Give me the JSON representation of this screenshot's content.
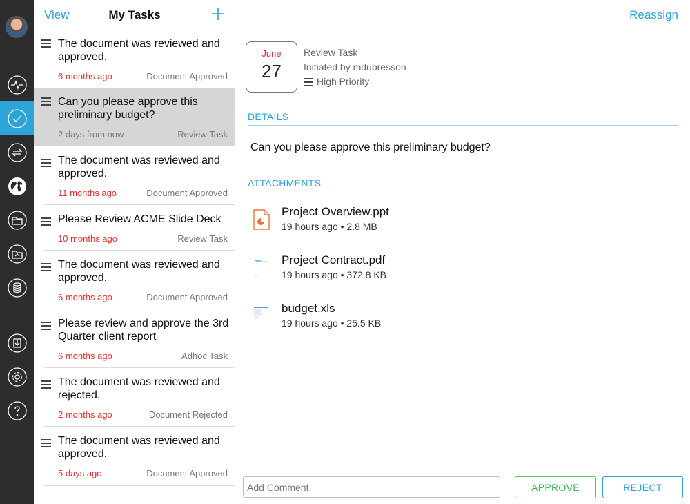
{
  "rail": {
    "icons": [
      "avatar",
      "activity-icon",
      "tasks-checkmark-icon",
      "sync-icon",
      "globe-icon",
      "folder-icon",
      "shared-folder-icon",
      "database-icon",
      "download-icon",
      "gear-icon",
      "help-icon"
    ],
    "active_icon": "tasks-checkmark-icon",
    "accent": "#2ea3d8",
    "background": "#2d2d2d"
  },
  "list": {
    "view_label": "View",
    "title": "My Tasks",
    "add_icon": "plus-icon",
    "tasks": [
      {
        "title": "The document was reviewed and approved.",
        "when": "6 months ago",
        "type": "Document Approved"
      },
      {
        "title": "Can you please approve this preliminary budget?",
        "when": "2 days from now",
        "type": "Review Task",
        "selected": true
      },
      {
        "title": "The document was reviewed and approved.",
        "when": "11 months ago",
        "type": "Document Approved"
      },
      {
        "title": "Please Review ACME Slide Deck",
        "when": "10 months ago",
        "type": "Review Task"
      },
      {
        "title": "The document was reviewed and approved.",
        "when": "6 months ago",
        "type": "Document Approved"
      },
      {
        "title": "Please review and approve the 3rd Quarter client report",
        "when": "6 months ago",
        "type": "Adhoc Task"
      },
      {
        "title": "The document was reviewed and rejected.",
        "when": "2 months ago",
        "type": "Document Rejected"
      },
      {
        "title": "The document was reviewed and approved.",
        "when": "5 days ago",
        "type": "Document Approved"
      }
    ]
  },
  "detail": {
    "reassign_label": "Reassign",
    "date": {
      "month": "June",
      "day": "27"
    },
    "task_type": "Review Task",
    "initiated_by": "Initiated by mdubresson",
    "priority": "High Priority",
    "details_label": "DETAILS",
    "details_text": "Can you please approve this preliminary budget?",
    "attachments_label": "ATTACHMENTS",
    "attachments": [
      {
        "name": "Project Overview.ppt",
        "meta": "19 hours ago • 2.8 MB",
        "icon": "ppt-file-icon"
      },
      {
        "name": "Project Contract.pdf",
        "meta": "19 hours ago • 372.8 KB",
        "icon": "pdf-thumbnail-icon"
      },
      {
        "name": "budget.xls",
        "meta": "19 hours ago • 25.5 KB",
        "icon": "xls-thumbnail-icon"
      }
    ]
  },
  "actions": {
    "comment_placeholder": "Add Comment",
    "approve_label": "APPROVE",
    "reject_label": "REJECT",
    "approve_color": "#3eb65a",
    "reject_color": "#2ea3d8"
  },
  "colors": {
    "overdue": "#e0312f",
    "selected_row": "#d6d6d6"
  }
}
